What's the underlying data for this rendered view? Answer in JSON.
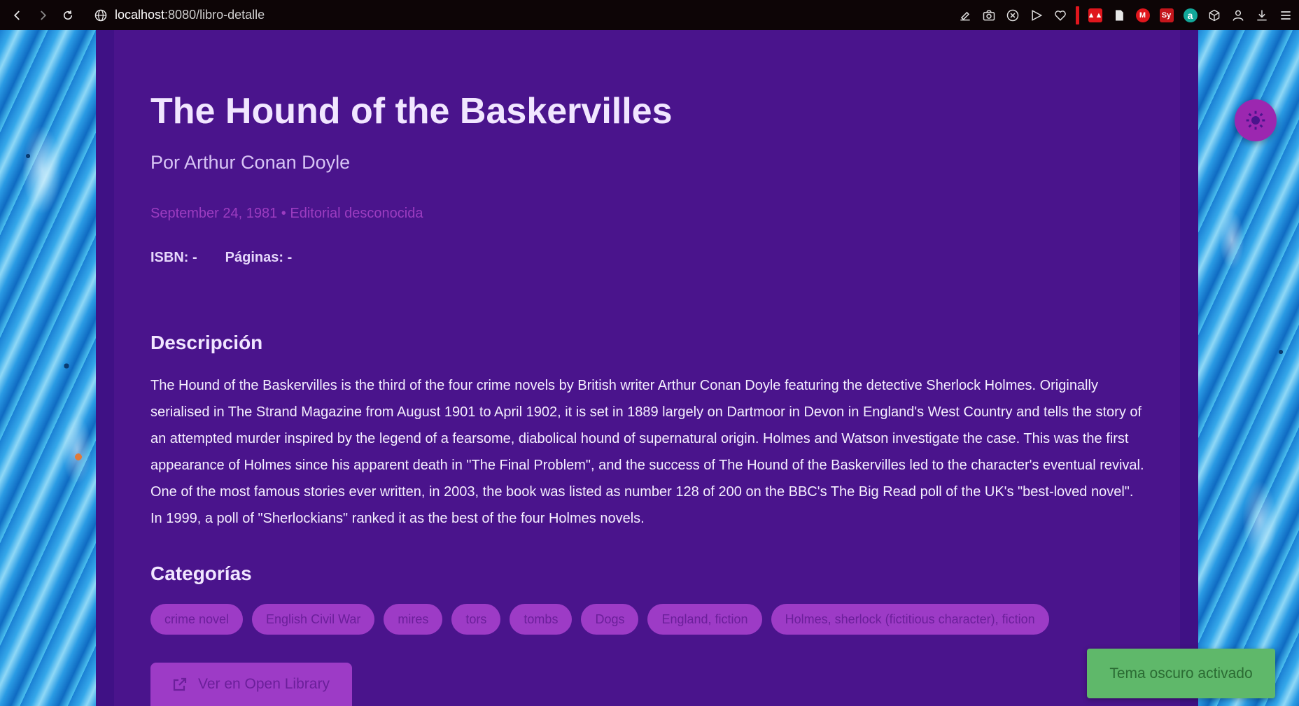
{
  "browser": {
    "url_host": "localhost",
    "url_path": ":8080/libro-detalle",
    "ext_sy_label": "Sy",
    "ext_m_label": "M",
    "ext_a_label": "a"
  },
  "book": {
    "title": "The Hound of the Baskervilles",
    "author_line": "Por Arthur Conan Doyle",
    "meta_line": "September 24, 1981 • Editorial desconocida",
    "isbn": "ISBN: -",
    "pages": "Páginas: -",
    "description_heading": "Descripción",
    "description": "The Hound of the Baskervilles is the third of the four crime novels by British writer Arthur Conan Doyle featuring the detective Sherlock Holmes. Originally serialised in The Strand Magazine from August 1901 to April 1902, it is set in 1889 largely on Dartmoor in Devon in England's West Country and tells the story of an attempted murder inspired by the legend of a fearsome, diabolical hound of supernatural origin. Holmes and Watson investigate the case. This was the first appearance of Holmes since his apparent death in \"The Final Problem\", and the success of The Hound of the Baskervilles led to the character's eventual revival. One of the most famous stories ever written, in 2003, the book was listed as number 128 of 200 on the BBC's The Big Read poll of the UK's \"best-loved novel\". In 1999, a poll of \"Sherlockians\" ranked it as the best of the four Holmes novels.",
    "categories_heading": "Categorías",
    "categories": [
      "crime novel",
      "English Civil War",
      "mires",
      "tors",
      "tombs",
      "Dogs",
      "England, fiction",
      "Holmes, sherlock (fictitious character), fiction"
    ],
    "open_library_label": "Ver en Open Library"
  },
  "toast": {
    "message": "Tema oscuro activado"
  },
  "colors": {
    "card": "#4a148c",
    "accent": "#9c27b0",
    "toast": "#5fb86a"
  }
}
